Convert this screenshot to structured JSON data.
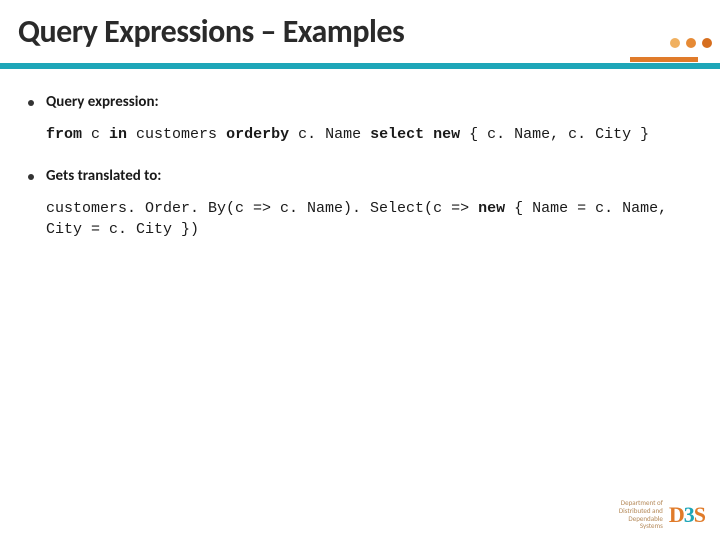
{
  "title": "Query Expressions – Examples",
  "bullets": {
    "b1": "Query expression:",
    "b2": "Gets translated to:"
  },
  "code": {
    "line1": {
      "kw_from": "from",
      "t1": " c ",
      "kw_in": "in",
      "t2": " customers ",
      "kw_orderby": "orderby",
      "t3": " c. Name ",
      "kw_select": "select",
      "t4": " ",
      "kw_new": "new",
      "t5": " { c. Name, c. City }"
    },
    "line2": {
      "t1": "customers. Order. By(c => c. Name). Select(c => ",
      "kw_new": "new",
      "t2": " { Name = c. Name, City = c. City })"
    }
  },
  "footer": {
    "line1": "Department of",
    "line2": "Distributed and",
    "line3": "Dependable",
    "line4": "Systems",
    "logo_d": "D",
    "logo_3": "3",
    "logo_s": "S"
  }
}
